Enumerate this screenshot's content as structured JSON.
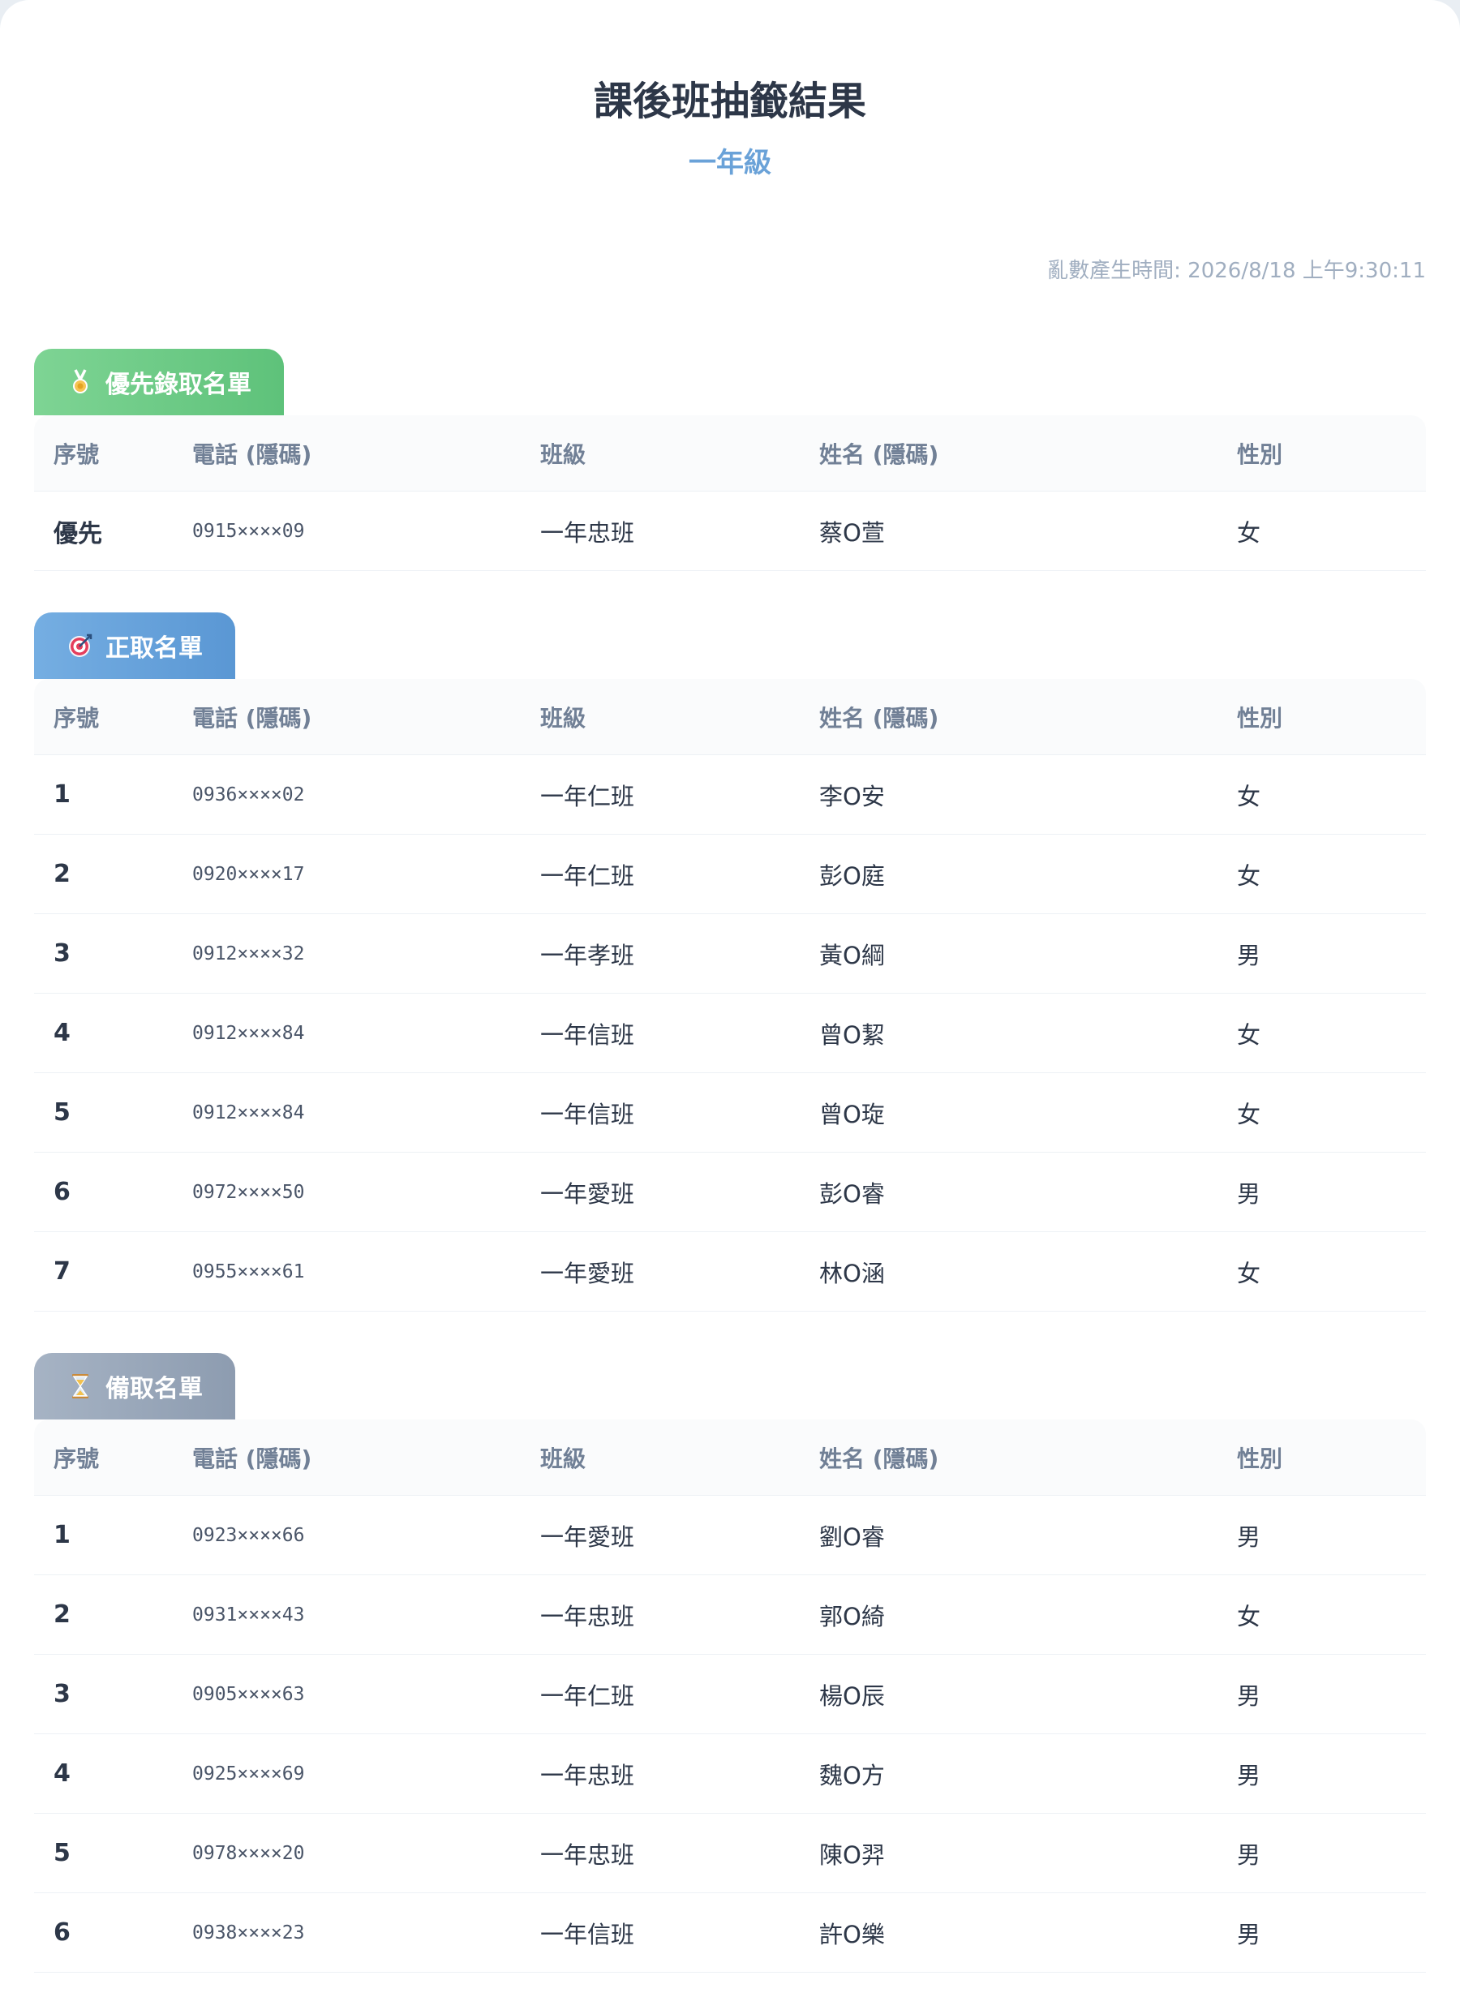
{
  "header": {
    "title": "課後班抽籤結果",
    "grade": "一年級",
    "timestamp": "亂數產生時間: 2026/8/18 上午9:30:11"
  },
  "columns": [
    "序號",
    "電話 (隱碼)",
    "班級",
    "姓名 (隱碼)",
    "性別"
  ],
  "sections": {
    "priority": {
      "title": "優先錄取名單",
      "icon": "medal-icon",
      "color": "#6cc986",
      "rows": [
        [
          "優先",
          "0915××××09",
          "一年忠班",
          "蔡O萱",
          "女"
        ]
      ]
    },
    "admitted": {
      "title": "正取名單",
      "icon": "target-icon",
      "color": "#68a3dc",
      "rows": [
        [
          "1",
          "0936××××02",
          "一年仁班",
          "李O安",
          "女"
        ],
        [
          "2",
          "0920××××17",
          "一年仁班",
          "彭O庭",
          "女"
        ],
        [
          "3",
          "0912××××32",
          "一年孝班",
          "黃O綱",
          "男"
        ],
        [
          "4",
          "0912××××84",
          "一年信班",
          "曾O絜",
          "女"
        ],
        [
          "5",
          "0912××××84",
          "一年信班",
          "曾O琁",
          "女"
        ],
        [
          "6",
          "0972××××50",
          "一年愛班",
          "彭O睿",
          "男"
        ],
        [
          "7",
          "0955××××61",
          "一年愛班",
          "林O涵",
          "女"
        ]
      ]
    },
    "waitlist": {
      "title": "備取名單",
      "icon": "hourglass-icon",
      "color": "#9aa8ba",
      "rows": [
        [
          "1",
          "0923××××66",
          "一年愛班",
          "劉O睿",
          "男"
        ],
        [
          "2",
          "0931××××43",
          "一年忠班",
          "郭O綺",
          "女"
        ],
        [
          "3",
          "0905××××63",
          "一年仁班",
          "楊O辰",
          "男"
        ],
        [
          "4",
          "0925××××69",
          "一年忠班",
          "魏O方",
          "男"
        ],
        [
          "5",
          "0978××××20",
          "一年忠班",
          "陳O羿",
          "男"
        ],
        [
          "6",
          "0938××××23",
          "一年信班",
          "許O樂",
          "男"
        ]
      ]
    }
  }
}
